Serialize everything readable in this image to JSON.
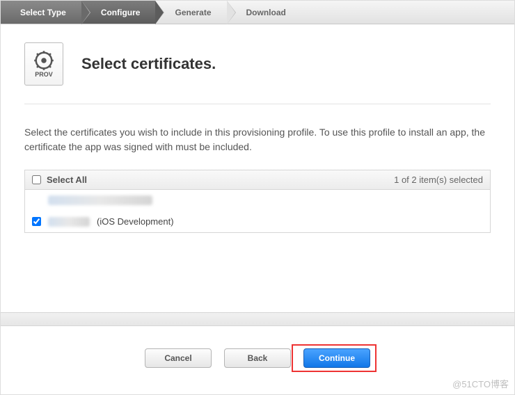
{
  "steps": {
    "select_type": "Select Type",
    "configure": "Configure",
    "generate": "Generate",
    "download": "Download"
  },
  "header": {
    "icon_label": "PROV",
    "title": "Select certificates."
  },
  "description": "Select the certificates you wish to include in this provisioning profile. To use this profile to install an app, the certificate the app was signed with must be included.",
  "list": {
    "select_all_label": "Select All",
    "count_text": "1 of 2 item(s) selected",
    "items": [
      {
        "checked": false,
        "name_hidden": true,
        "suffix": ""
      },
      {
        "checked": true,
        "name_hidden": true,
        "suffix": "(iOS Development)"
      }
    ]
  },
  "buttons": {
    "cancel": "Cancel",
    "back": "Back",
    "continue": "Continue"
  },
  "watermark": "@51CTO博客"
}
